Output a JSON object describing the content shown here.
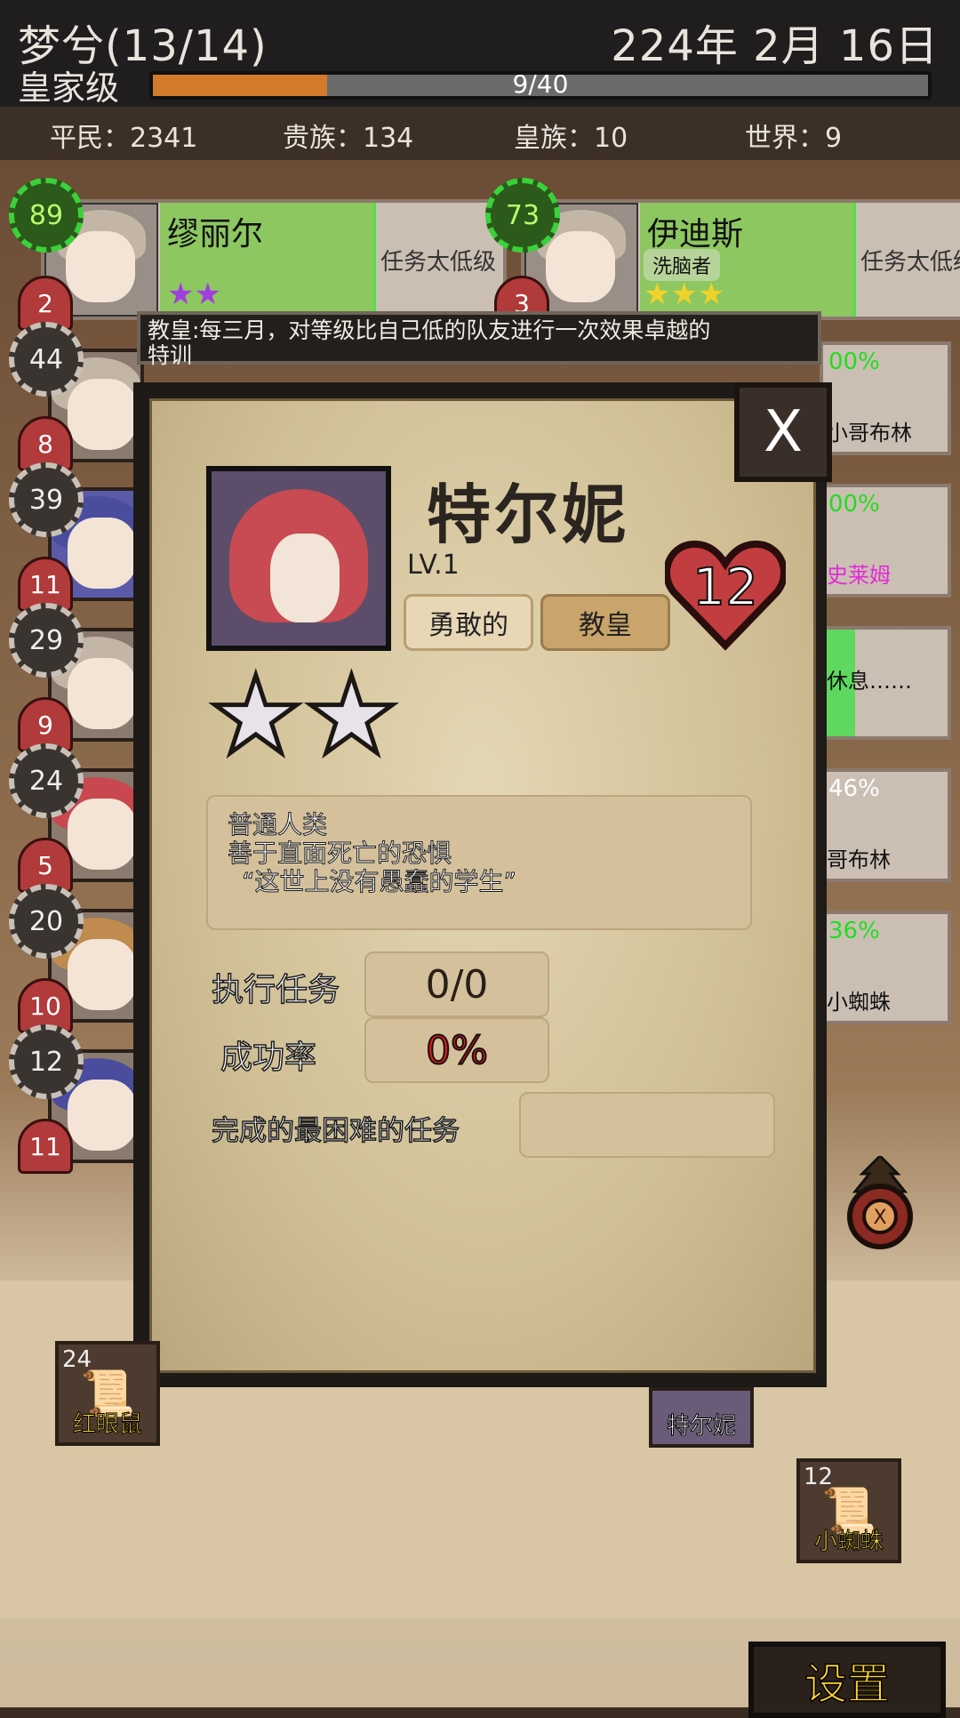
{
  "header": {
    "guild_name": "梦兮(13/14)",
    "date": "224年 2月 16日",
    "rank": "皇家级",
    "xp_text": "9/40",
    "xp_fraction": 0.225
  },
  "population": {
    "commoners": "平民：2341",
    "nobles": "贵族：134",
    "royals": "皇族：10",
    "world": "世界：9"
  },
  "cards": {
    "left": {
      "name": "缪丽尔",
      "note": "任务太低级",
      "level": "89",
      "heart": "2",
      "stars": 2
    },
    "right": {
      "name": "伊迪斯",
      "note": "任务太低级",
      "tag": "洗脑者",
      "level": "73",
      "heart": "3",
      "stars": 3
    }
  },
  "roster": [
    {
      "level": "44",
      "heart": "8"
    },
    {
      "level": "39",
      "heart": "11"
    },
    {
      "level": "29",
      "heart": "9"
    },
    {
      "level": "24",
      "heart": "5"
    },
    {
      "level": "20",
      "heart": "10"
    },
    {
      "level": "12",
      "heart": "11"
    }
  ],
  "right_cards": [
    {
      "pct": "00%",
      "label": "小哥布林"
    },
    {
      "pct": "00%",
      "label": "史莱姆"
    },
    {
      "pct": "",
      "label": "休息……"
    },
    {
      "pct": "46%",
      "label": "哥布林"
    },
    {
      "pct": "36%",
      "label": "小蜘蛛"
    }
  ],
  "tooltip": {
    "line1": "教皇:每三月，对等级比自己低的队友进行一次效果卓越的",
    "line2": "特训"
  },
  "modal": {
    "close": "X",
    "name": "特尔妮",
    "level": "LV.1",
    "trait1": "勇敢的",
    "trait2": "教皇",
    "heart": "12",
    "stars": 2,
    "desc": [
      "普通人类",
      "善于直面死亡的恐惧",
      "“这世上没有愚蠢的学生”"
    ],
    "missions_label": "执行任务",
    "missions_value": "0/0",
    "success_label": "成功率",
    "success_value": "0%",
    "hardest_label": "完成的最困难的任务",
    "hardest_value": ""
  },
  "tokens": [
    {
      "num": "24",
      "label": "红眼鼠"
    },
    {
      "num": "",
      "label": "特尔妮"
    },
    {
      "num": "12",
      "label": "小蜘蛛"
    }
  ],
  "settings": "设置",
  "colors": {
    "xp": "#d07a2a",
    "success": "#e01818",
    "card_green": "#8dc760"
  }
}
